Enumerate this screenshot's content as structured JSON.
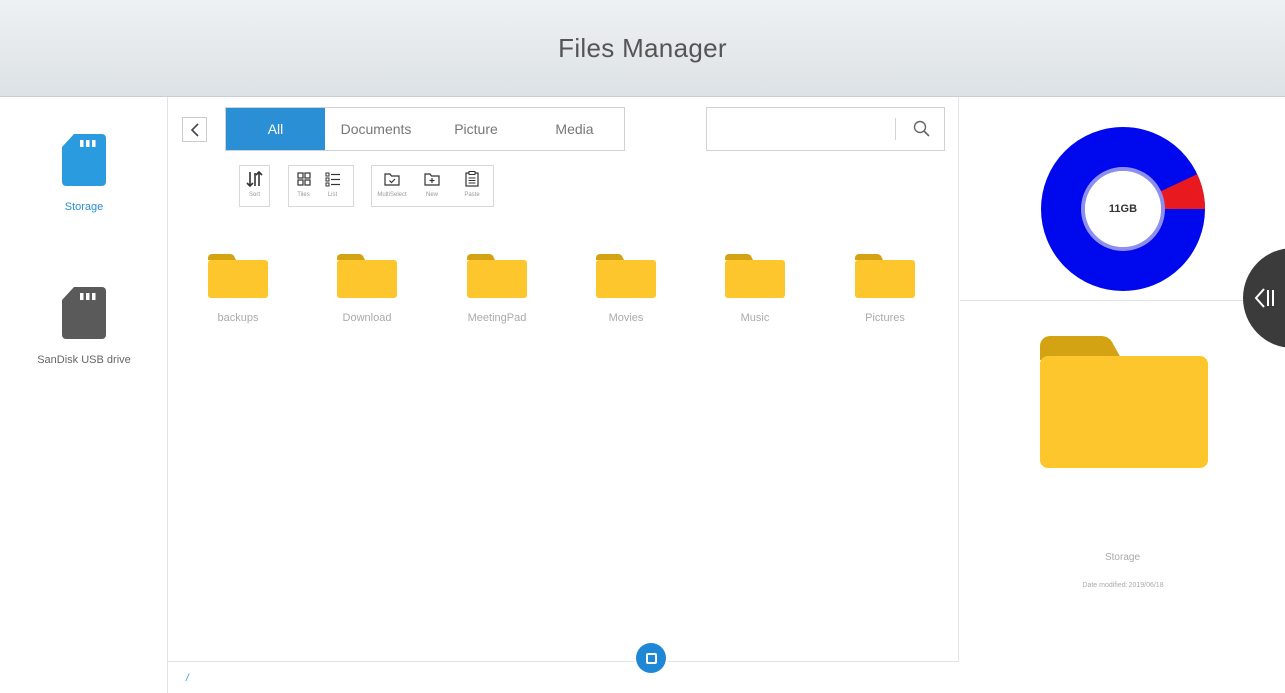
{
  "window": {
    "title": "Files Manager"
  },
  "sidebar": {
    "items": [
      {
        "label": "Storage",
        "icon": "sd-card-icon",
        "color": "#2b9be0",
        "active": true
      },
      {
        "label": "SanDisk USB drive",
        "icon": "sd-card-icon",
        "color": "#5a5a5a",
        "active": false
      }
    ]
  },
  "tabs": [
    {
      "label": "All",
      "active": true
    },
    {
      "label": "Documents",
      "active": false
    },
    {
      "label": "Picture",
      "active": false
    },
    {
      "label": "Media",
      "active": false
    }
  ],
  "search": {
    "placeholder": "",
    "value": "",
    "icon": "search-icon"
  },
  "toolbar": {
    "sort": {
      "label": "Sort",
      "icon": "sort-icon"
    },
    "tiles": {
      "label": "Tiles",
      "icon": "tiles-icon"
    },
    "list": {
      "label": "List",
      "icon": "list-icon"
    },
    "multiselect": {
      "label": "MultiSelect",
      "icon": "multiselect-icon"
    },
    "new": {
      "label": "New",
      "icon": "new-folder-icon"
    },
    "paste": {
      "label": "Paste",
      "icon": "paste-icon"
    }
  },
  "folders": [
    {
      "name": "backups"
    },
    {
      "name": "Download"
    },
    {
      "name": "MeetingPad"
    },
    {
      "name": "Movies"
    },
    {
      "name": "Music"
    },
    {
      "name": "Pictures"
    }
  ],
  "path": "/",
  "storage_chart": {
    "total_label": "11GB",
    "small_label": "",
    "used_fraction": 0.07,
    "used_color": "#e8191f",
    "free_color": "#0008ee"
  },
  "details": {
    "name": "Storage",
    "date_modified_label": "Date modified:",
    "date_modified": "2019/06/18"
  },
  "colors": {
    "accent": "#2b8fd6",
    "folder": "#fdc62d",
    "folder_tab": "#d4a314"
  }
}
